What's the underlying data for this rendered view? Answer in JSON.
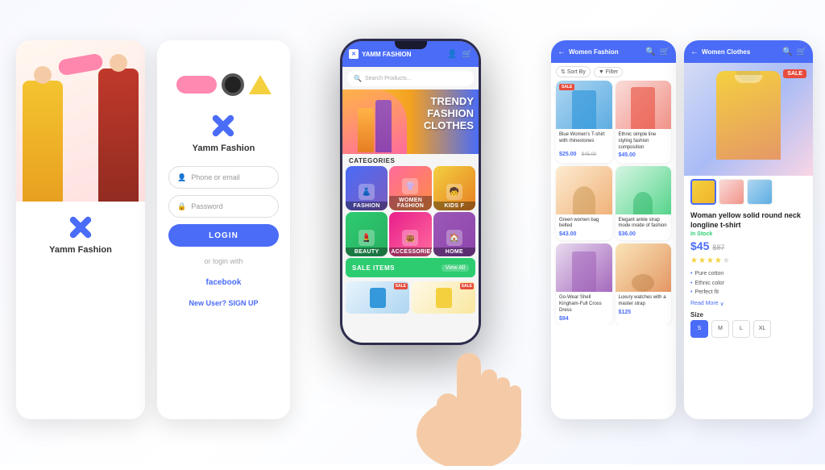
{
  "app": {
    "name": "Yamm Fashion",
    "tagline": "TRENDY FASHION CLOTHES"
  },
  "left_splash": {
    "brand": "Yamm Fashion",
    "logo_icon": "✕"
  },
  "login_panel": {
    "brand": "Yamm Fashion",
    "logo_icon": "✕",
    "phone_placeholder": "Phone or email",
    "password_placeholder": "Password",
    "login_button": "LOGIN",
    "or_text": "or login with",
    "facebook_text": "facebook",
    "new_user_text": "New User?",
    "sign_up_text": "SIGN UP"
  },
  "phone": {
    "header_title": "YAMM FASHION",
    "search_placeholder": "Search Products...",
    "banner_text": "TRENDY\nFASHION\nCLOTHES",
    "categories_label": "CATEGORIES",
    "categories": [
      {
        "id": "fashion",
        "label": "Fashion"
      },
      {
        "id": "women-fashion",
        "label": "WOMEN FASHION"
      },
      {
        "id": "kids",
        "label": "KIDS F"
      },
      {
        "id": "beauty",
        "label": "BEAUTY"
      },
      {
        "id": "accessories",
        "label": "ACCESSORIES"
      },
      {
        "id": "home",
        "label": "HOME"
      }
    ],
    "sale_label": "SALE ITEMS",
    "view_all_label": "View All"
  },
  "women_panel": {
    "title": "Women Fashion",
    "sort_label": "Sort By",
    "filter_label": "Filter",
    "products": [
      {
        "name": "Blue Women's T-shirt with rhinestones",
        "price": "$25.00",
        "old_price": "$45.00",
        "sale": true,
        "color": "blue"
      },
      {
        "name": "Ethnic simple line styling fashion composition",
        "price": "$45.00",
        "old_price": "",
        "sale": false,
        "color": "pink"
      },
      {
        "name": "Green women bag belted",
        "price": "$43.00",
        "old_price": "",
        "sale": false,
        "color": "beige"
      },
      {
        "name": "Elegant ankle strap mode inside of fashion",
        "price": "$36.00",
        "old_price": "",
        "sale": false,
        "color": "green"
      },
      {
        "name": "Go-Wear Shell Kingham-Full Cross Dress",
        "price": "$94",
        "old_price": "",
        "sale": false,
        "color": "purple"
      },
      {
        "name": "Luxury watches with a master strap",
        "price": "$125",
        "old_price": "",
        "sale": false,
        "color": "tan"
      }
    ]
  },
  "detail_panel": {
    "title": "Women Clothes",
    "back_icon": "←",
    "product_name": "Woman yellow solid round neck longline t-shirt",
    "in_stock": "In Stock",
    "price": "$45",
    "old_price": "$87",
    "stars": 4,
    "features": [
      "Pure cotton",
      "Ethnic color",
      "Perfect fit"
    ],
    "read_more": "Read More",
    "size_label": "Size",
    "sizes": [
      "S",
      "M",
      "L",
      "XL"
    ],
    "active_size": "S",
    "sale_badge": "SALE"
  }
}
